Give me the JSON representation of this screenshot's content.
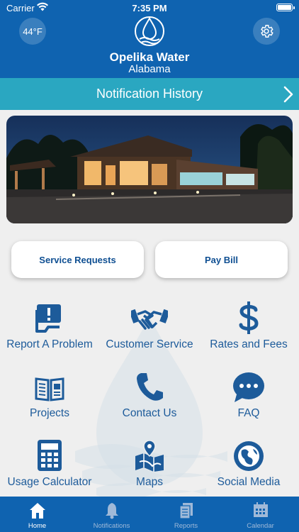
{
  "status": {
    "carrier": "Carrier",
    "time": "7:35 PM"
  },
  "header": {
    "temperature": "44°F",
    "brand_name": "Opelika Water",
    "brand_sub": "Alabama"
  },
  "notification_bar": {
    "label": "Notification History"
  },
  "actions": {
    "service_requests": "Service Requests",
    "pay_bill": "Pay Bill"
  },
  "grid": [
    {
      "label": "Report A Problem",
      "icon": "report-problem-icon"
    },
    {
      "label": "Customer Service",
      "icon": "handshake-icon"
    },
    {
      "label": "Rates and Fees",
      "icon": "dollar-icon"
    },
    {
      "label": "Projects",
      "icon": "open-book-icon"
    },
    {
      "label": "Contact Us",
      "icon": "phone-icon"
    },
    {
      "label": "FAQ",
      "icon": "chat-bubble-icon"
    },
    {
      "label": "Usage Calculator",
      "icon": "calculator-icon"
    },
    {
      "label": "Maps",
      "icon": "map-pin-icon"
    },
    {
      "label": "Social Media",
      "icon": "globe-icon"
    }
  ],
  "tabs": [
    {
      "label": "Home",
      "icon": "home-icon",
      "active": true
    },
    {
      "label": "Notifications",
      "icon": "bell-icon",
      "active": false
    },
    {
      "label": "Reports",
      "icon": "document-icon",
      "active": false
    },
    {
      "label": "Calendar",
      "icon": "calendar-icon",
      "active": false
    }
  ],
  "colors": {
    "header_blue": "#0f63b0",
    "notification_teal": "#2aa7c1",
    "icon_blue": "#1d5b9a",
    "background": "#efefef"
  }
}
